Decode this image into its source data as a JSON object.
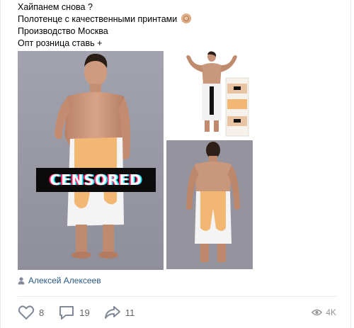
{
  "post": {
    "lines": [
      "Хайпанем снова ?",
      "Полотенце с качественными принтами",
      "Производство Москва",
      "Опт розница ставь +"
    ]
  },
  "photos": {
    "censor_label": "CENSORED"
  },
  "author": {
    "name": "Алексей Алексеев"
  },
  "actions": {
    "likes": "8",
    "comments": "19",
    "shares": "11",
    "views": "4K"
  },
  "colors": {
    "link": "#2a5885",
    "icon": "#828a99",
    "count": "#656565",
    "divider": "#e7e8ec"
  },
  "icons": [
    "user-icon",
    "heart-icon",
    "comment-icon",
    "share-icon",
    "eye-icon"
  ]
}
